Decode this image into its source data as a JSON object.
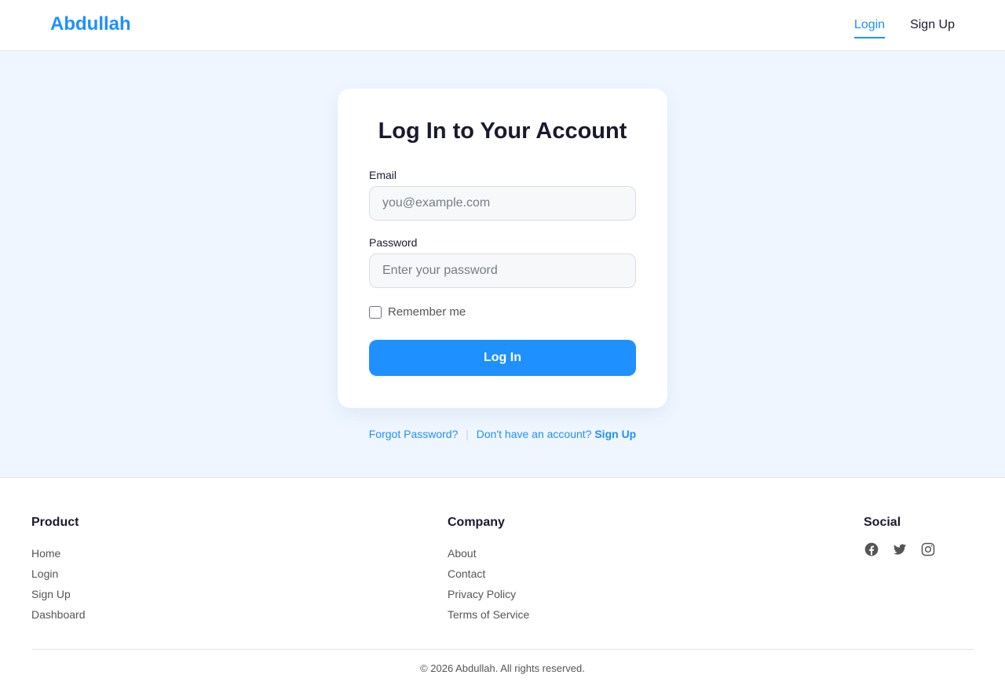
{
  "header": {
    "brand": "Abdullah",
    "nav": {
      "login": "Login",
      "signup": "Sign Up"
    }
  },
  "card": {
    "title": "Log In to Your Account",
    "email_label": "Email",
    "email_placeholder": "you@example.com",
    "password_label": "Password",
    "password_placeholder": "Enter your password",
    "remember_label": "Remember me",
    "submit_label": "Log In"
  },
  "below_card": {
    "forgot": "Forgot Password?",
    "separator": "|",
    "no_account": "Don't have an account?",
    "signup": "Sign Up"
  },
  "footer": {
    "product": {
      "title": "Product",
      "items": [
        "Home",
        "Login",
        "Sign Up",
        "Dashboard"
      ]
    },
    "company": {
      "title": "Company",
      "items": [
        "About",
        "Contact",
        "Privacy Policy",
        "Terms of Service"
      ]
    },
    "social": {
      "title": "Social",
      "icons": [
        "facebook-icon",
        "twitter-icon",
        "instagram-icon"
      ]
    },
    "copyright": "© 2026 Abdullah. All rights reserved."
  },
  "colors": {
    "accent": "#1e90ff",
    "background": "#eff6ff",
    "text": "#1a1a2e"
  }
}
